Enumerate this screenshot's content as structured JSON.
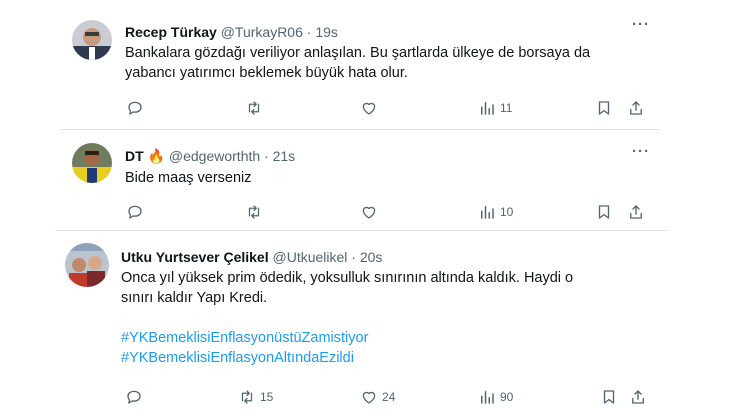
{
  "tweets": [
    {
      "name": "Recep Türkay",
      "handle": "@TurkayR06",
      "time": "· 19s",
      "lines": [
        "Bankalara gözdağı veriliyor anlaşılan. Bu şartlarda ülkeye de borsaya da",
        "yabancı yatırımcı beklemek büyük hata olur."
      ],
      "hashtags": [],
      "stats": {
        "replies": "",
        "retweets": "",
        "likes": "",
        "views": "11"
      }
    },
    {
      "name": "DT",
      "emoji": "🔥",
      "handle": "@edgeworthth",
      "time": "· 21s",
      "lines": [
        "Bide maaş verseniz"
      ],
      "hashtags": [],
      "stats": {
        "replies": "",
        "retweets": "",
        "likes": "",
        "views": "10"
      }
    },
    {
      "name": "Utku Yurtsever Çelikel",
      "handle": "@Utkuelikel",
      "time": "· 20s",
      "lines": [
        "Onca yıl yüksek prim ödedik, yoksulluk sınırının altında kaldık. Haydi o",
        "sınırı kaldır Yapı Kredi."
      ],
      "hashtags": [
        "#YKBemeklisiEnflasyonüstüZamistiyor",
        "#YKBemeklisiEnflasyonAltındaEzildi"
      ],
      "stats": {
        "replies": "",
        "retweets": "15",
        "likes": "24",
        "views": "90"
      }
    }
  ],
  "icons": {
    "reply": "reply-icon",
    "retweet": "retweet-icon",
    "like": "like-icon",
    "views": "views-icon",
    "bookmark": "bookmark-icon",
    "share": "share-icon",
    "more": "more-icon"
  },
  "colors": {
    "hashtag": "#1d9bf0",
    "secondary": "#536471",
    "separator": "#dfe3e6"
  }
}
